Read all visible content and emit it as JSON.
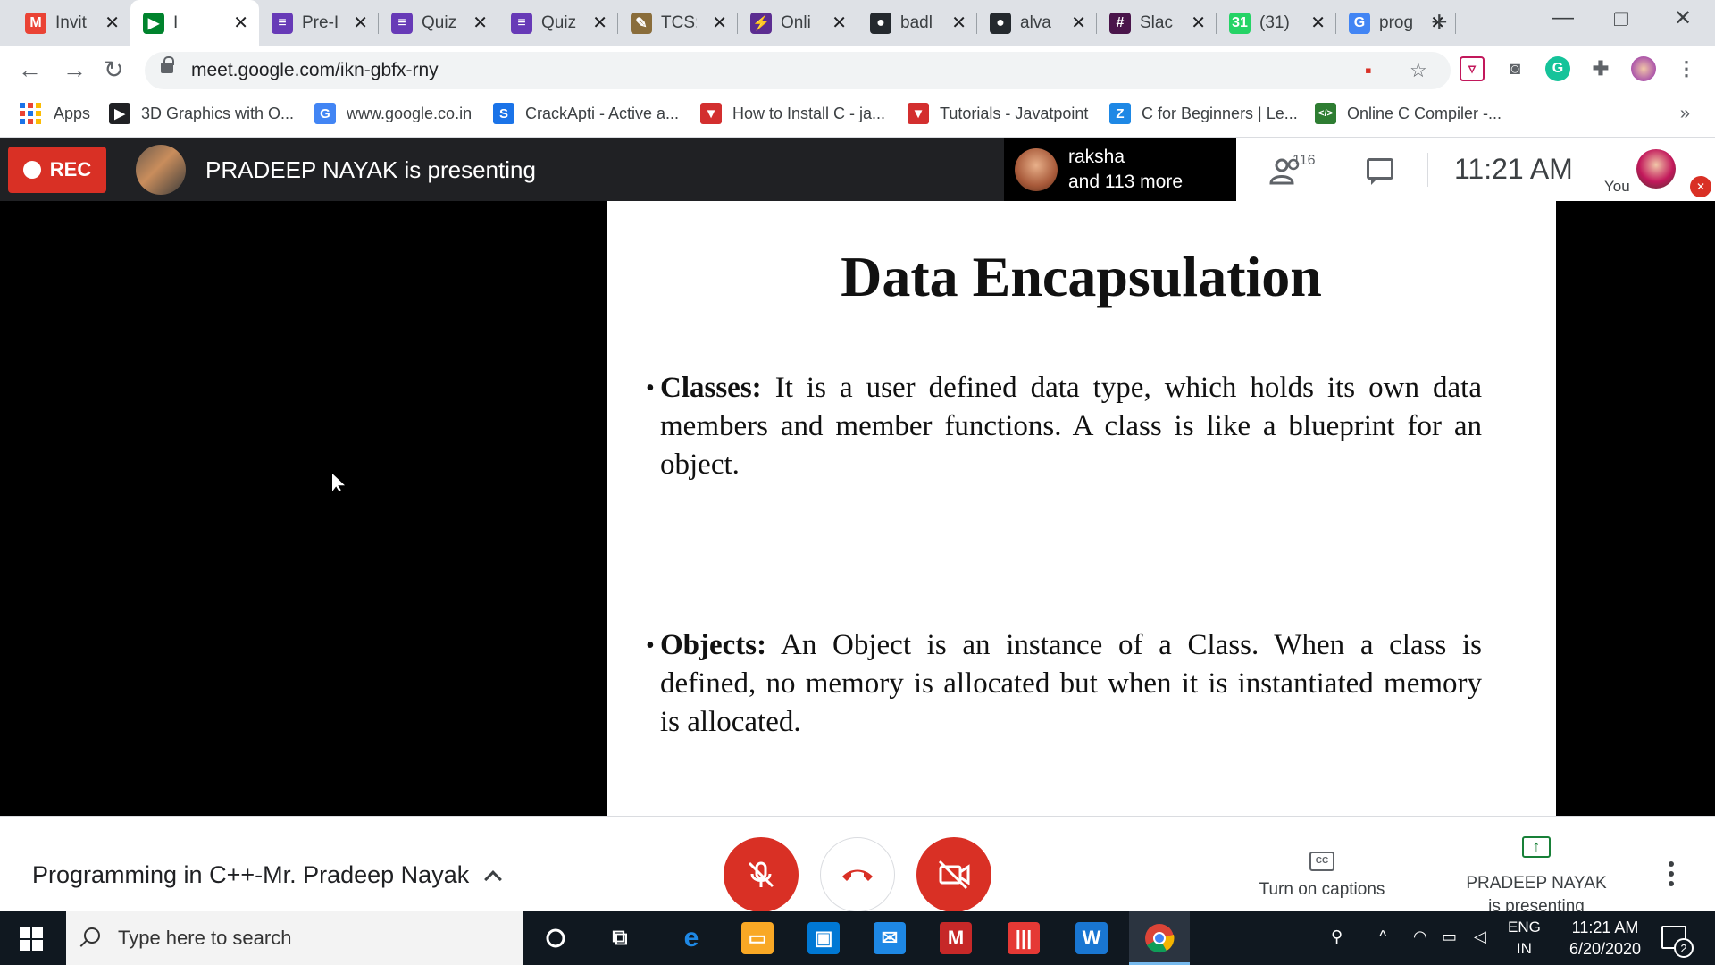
{
  "browser": {
    "tabs": [
      {
        "label": "Invit",
        "icon": "gmail-icon",
        "color": "#ea4335",
        "glyph": "M"
      },
      {
        "label": "I",
        "icon": "meet-icon",
        "color": "#00832d",
        "glyph": "▶",
        "active": true
      },
      {
        "label": "Pre-I",
        "icon": "forms-icon",
        "color": "#673ab7",
        "glyph": "≡"
      },
      {
        "label": "Quiz",
        "icon": "forms-icon",
        "color": "#673ab7",
        "glyph": "≡"
      },
      {
        "label": "Quiz",
        "icon": "forms-icon",
        "color": "#673ab7",
        "glyph": "≡"
      },
      {
        "label": "TCS:",
        "icon": "tcs-icon",
        "color": "#8a6d3b",
        "glyph": "✎"
      },
      {
        "label": "Onli",
        "icon": "bolt-icon",
        "color": "#5c2d91",
        "glyph": "⚡"
      },
      {
        "label": "badl",
        "icon": "github-icon",
        "color": "#24292e",
        "glyph": "●"
      },
      {
        "label": "alva",
        "icon": "github-icon",
        "color": "#24292e",
        "glyph": "●"
      },
      {
        "label": "Slac",
        "icon": "slack-icon",
        "color": "#4a154b",
        "glyph": "#"
      },
      {
        "label": "(31)",
        "icon": "whatsapp-icon",
        "color": "#25d366",
        "glyph": "31"
      },
      {
        "label": "prog",
        "icon": "google-icon",
        "color": "#4285f4",
        "glyph": "G"
      }
    ],
    "url": "meet.google.com/ikn-gbfx-rny",
    "bookmarks": [
      {
        "label": "Apps",
        "icon": "apps-icon"
      },
      {
        "label": "3D Graphics with O...",
        "icon": "graphics-icon",
        "color": "#202124",
        "glyph": "▶"
      },
      {
        "label": "www.google.co.in",
        "icon": "google-icon",
        "color": "#4285f4",
        "glyph": "G"
      },
      {
        "label": "CrackApti - Active a...",
        "icon": "crackapti-icon",
        "color": "#1a73e8",
        "glyph": "S"
      },
      {
        "label": "How to Install C - ja...",
        "icon": "javatpoint-icon",
        "color": "#d32f2f",
        "glyph": "▼"
      },
      {
        "label": "Tutorials - Javatpoint",
        "icon": "javatpoint-icon",
        "color": "#d32f2f",
        "glyph": "▼"
      },
      {
        "label": "C for Beginners | Le...",
        "icon": "learn-icon",
        "color": "#1e88e5",
        "glyph": "Z"
      },
      {
        "label": "Online C Compiler -...",
        "icon": "code-icon",
        "color": "#2e7d32",
        "glyph": "</>"
      }
    ],
    "more_bookmarks": "»"
  },
  "meet": {
    "rec_label": "REC",
    "presenting_title": "PRADEEP NAYAK is presenting",
    "participant_name": "raksha",
    "participant_more": "and 113 more",
    "participant_count": "116",
    "time": "11:21  AM",
    "you_label": "You",
    "meeting_name": "Programming in C++-Mr. Pradeep Nayak",
    "captions_label": "Turn on captions",
    "present_status_line1": "PRADEEP NAYAK",
    "present_status_line2": "is presenting"
  },
  "slide": {
    "title": "Data Encapsulation",
    "bullets": [
      {
        "term": "Classes:",
        "text": " It is a user defined data type, which holds its own data members and member functions. A class is like a blueprint for an object."
      },
      {
        "term": "Objects:",
        "text": " An Object is an instance of a Class. When a class is defined, no memory is allocated but when it is instantiated memory is allocated."
      }
    ]
  },
  "taskbar": {
    "search_placeholder": "Type here to search",
    "lang_line1": "ENG",
    "lang_line2": "IN",
    "time": "11:21 AM",
    "date": "6/20/2020",
    "notification_count": "2"
  }
}
